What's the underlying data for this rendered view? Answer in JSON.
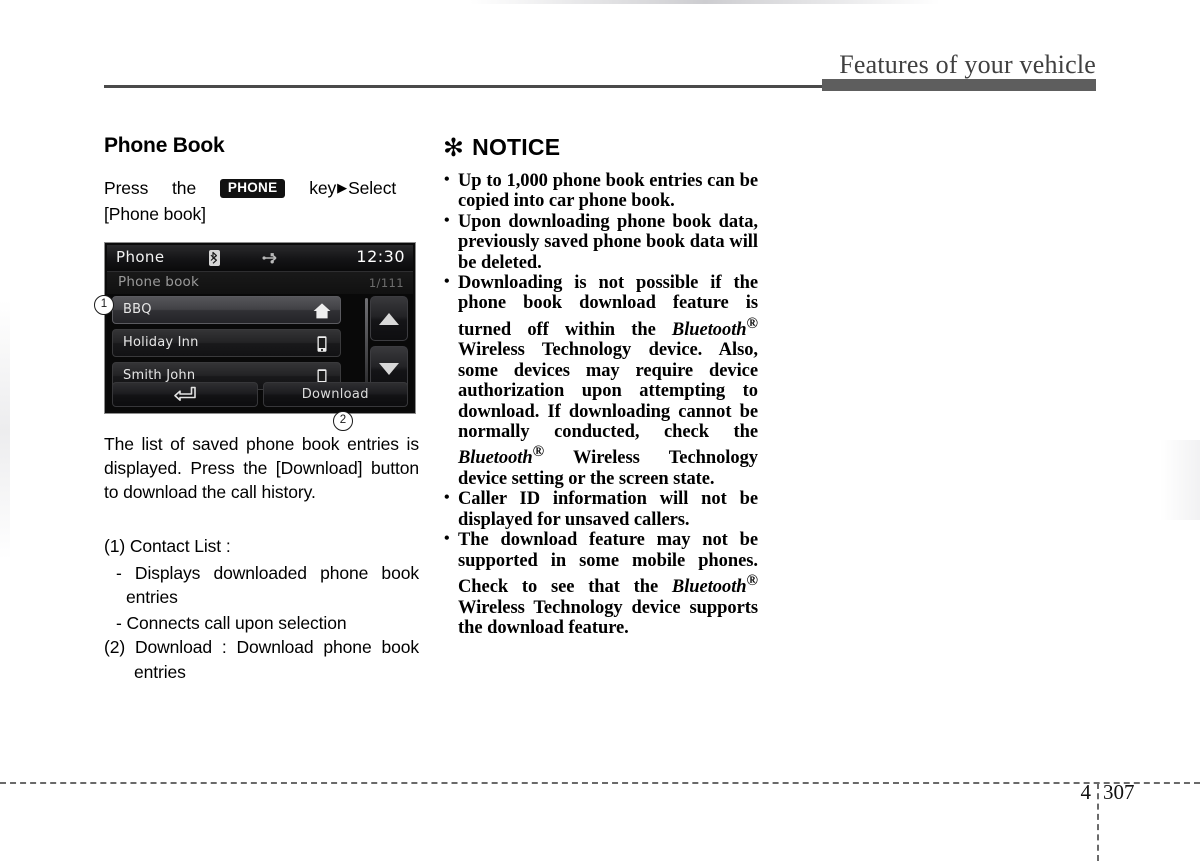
{
  "header": {
    "title": "Features of your vehicle"
  },
  "left": {
    "section_title": "Phone Book",
    "intro_a": "Press",
    "intro_b": "the",
    "key_label": "PHONE",
    "intro_c": "key",
    "intro_arrow": "▶",
    "intro_d": "Select",
    "intro_e": "[Phone book]",
    "body_paragraph": "The list of saved phone book entries is displayed. Press the [Download] button to download the call history.",
    "items": [
      {
        "marker": "(1)",
        "label": "Contact List :",
        "subitems": [
          "- Displays   downloaded   phone book entries",
          "- Connects call upon selection"
        ]
      },
      {
        "marker": "(2)",
        "label": "Download  :  Download   phone book entries",
        "subitems": []
      }
    ]
  },
  "device": {
    "title": "Phone",
    "clock": "12:30",
    "bluetooth_icon": "bluetooth-icon",
    "usb_icon": "usb-icon",
    "subtitle": "Phone book",
    "count": "1/111",
    "rows": [
      {
        "name": "BBQ",
        "icon": "home-icon",
        "selected": true
      },
      {
        "name": "Holiday Inn",
        "icon": "mobile-phone-icon",
        "selected": false
      },
      {
        "name": "Smith John",
        "icon": "mobile-phone-icon",
        "selected": false
      }
    ],
    "scroll_up": "▲",
    "scroll_down": "▼",
    "back_icon": "back-arrow-icon",
    "download_label": "Download",
    "callout_1": "1",
    "callout_2": "2"
  },
  "notice": {
    "asterisk": "✻",
    "heading": "NOTICE",
    "bullets": [
      {
        "parts": [
          {
            "t": "Up to 1,000 phone book entries can be copied into car phone book."
          }
        ]
      },
      {
        "parts": [
          {
            "t": "Upon downloading phone book data, previously saved phone book data will be deleted."
          }
        ]
      },
      {
        "parts": [
          {
            "t": "Downloading is not possible if the phone book download feature is turned off within the "
          },
          {
            "t": "Bluetooth",
            "style": "bt"
          },
          {
            "t": "®",
            "style": "sup"
          },
          {
            "t": " Wireless Technology device. Also, some devices may require device authorization upon attempting to download. If downloading cannot be normally conducted, check the "
          },
          {
            "t": "Bluetooth",
            "style": "bt"
          },
          {
            "t": "®",
            "style": "sup"
          },
          {
            "t": " Wireless Technology device setting or the screen state."
          }
        ]
      },
      {
        "parts": [
          {
            "t": "Caller ID information will not be displayed for unsaved callers."
          }
        ]
      },
      {
        "parts": [
          {
            "t": "The download feature may not be supported in some mobile phones. Check to see that the "
          },
          {
            "t": "Bluetooth",
            "style": "bt"
          },
          {
            "t": "®",
            "style": "sup"
          },
          {
            "t": " Wireless Technology device supports the download feature."
          }
        ]
      }
    ]
  },
  "footer": {
    "chapter": "4",
    "page": "307"
  }
}
